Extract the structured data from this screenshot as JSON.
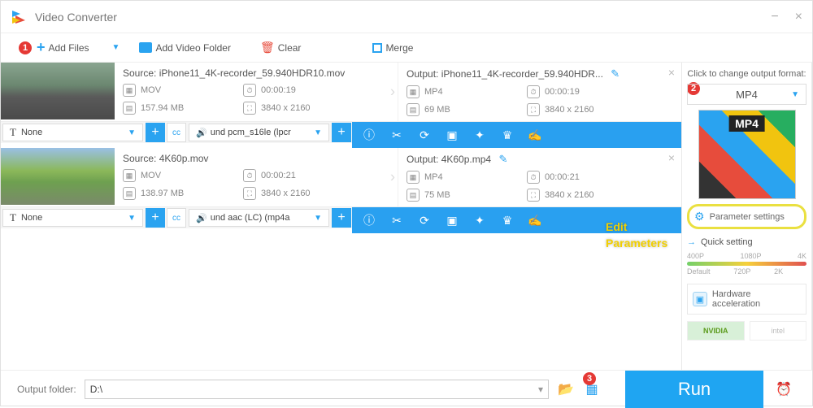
{
  "app_title": "Video Converter",
  "toolbar": {
    "add_files": "Add Files",
    "add_folder": "Add Video Folder",
    "clear": "Clear",
    "merge": "Merge"
  },
  "items": [
    {
      "source_prefix": "Source:",
      "source_name": "iPhone11_4K-recorder_59.940HDR10.mov",
      "fmt_in": "MOV",
      "dur_in": "00:00:19",
      "size_in": "157.94 MB",
      "res_in": "3840 x 2160",
      "output_prefix": "Output:",
      "output_name": "iPhone11_4K-recorder_59.940HDR...",
      "fmt_out": "MP4",
      "dur_out": "00:00:19",
      "size_out": "69 MB",
      "res_out": "3840 x 2160",
      "sub_track": "None",
      "audio_track": "und pcm_s16le (lpcr"
    },
    {
      "source_prefix": "Source:",
      "source_name": "4K60p.mov",
      "fmt_in": "MOV",
      "dur_in": "00:00:21",
      "size_in": "138.97 MB",
      "res_in": "3840 x 2160",
      "output_prefix": "Output:",
      "output_name": "4K60p.mp4",
      "fmt_out": "MP4",
      "dur_out": "00:00:21",
      "size_out": "75 MB",
      "res_out": "3840 x 2160",
      "sub_track": "None",
      "audio_track": "und aac (LC) (mp4a"
    }
  ],
  "sidebar": {
    "label": "Click to change output format:",
    "format": "MP4",
    "param_settings": "Parameter settings",
    "quick_setting": "Quick setting",
    "ticks": {
      "t0": "400P",
      "t1": "720P",
      "t2": "1080P",
      "t3": "2K",
      "t4": "4K",
      "def": "Default"
    },
    "hw_accel": "Hardware acceleration",
    "nvidia": "NVIDIA",
    "intel": "intel"
  },
  "annot": {
    "line1": "Edit",
    "line2": "Parameters"
  },
  "footer": {
    "label": "Output folder:",
    "path": "D:\\",
    "run": "Run"
  }
}
